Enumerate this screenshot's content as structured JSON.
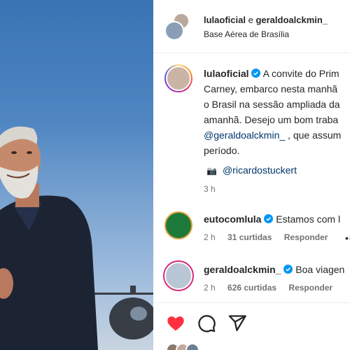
{
  "post": {
    "header": {
      "user1": "lulaoficial",
      "conjunction": " e ",
      "user2": "geraldoalckmin_",
      "location": "Base Aérea de Brasília"
    },
    "caption": {
      "username": "lulaoficial",
      "line1": " A convite do Prim",
      "line2": "Carney, embarco nesta manhã",
      "line3": "o Brasil na sessão ampliada da",
      "line4": "amanhã. Desejo um bom traba",
      "line5_mention": "@geraldoalckmin_",
      "line5_rest": " , que assum",
      "line6": "período.",
      "credit_mention": "@ricardostuckert",
      "credit_icon": "camera-emoji",
      "time": "3 h"
    },
    "comments": [
      {
        "username": "eutocomlula",
        "text": " Estamos com l",
        "time": "2 h",
        "likes": "31 curtidas",
        "reply": "Responder",
        "more": "•••"
      },
      {
        "username": "geraldoalckmin_",
        "text": " Boa viagen",
        "time": "2 h",
        "likes": "626 curtidas",
        "reply": "Responder"
      }
    ],
    "actions": {
      "like_icon": "heart-filled-red",
      "comment_icon": "speech-bubble",
      "share_icon": "paper-plane"
    }
  },
  "colors": {
    "verified": "#0095f6",
    "like": "#ff3040",
    "link": "#00376b",
    "muted": "#737373"
  }
}
